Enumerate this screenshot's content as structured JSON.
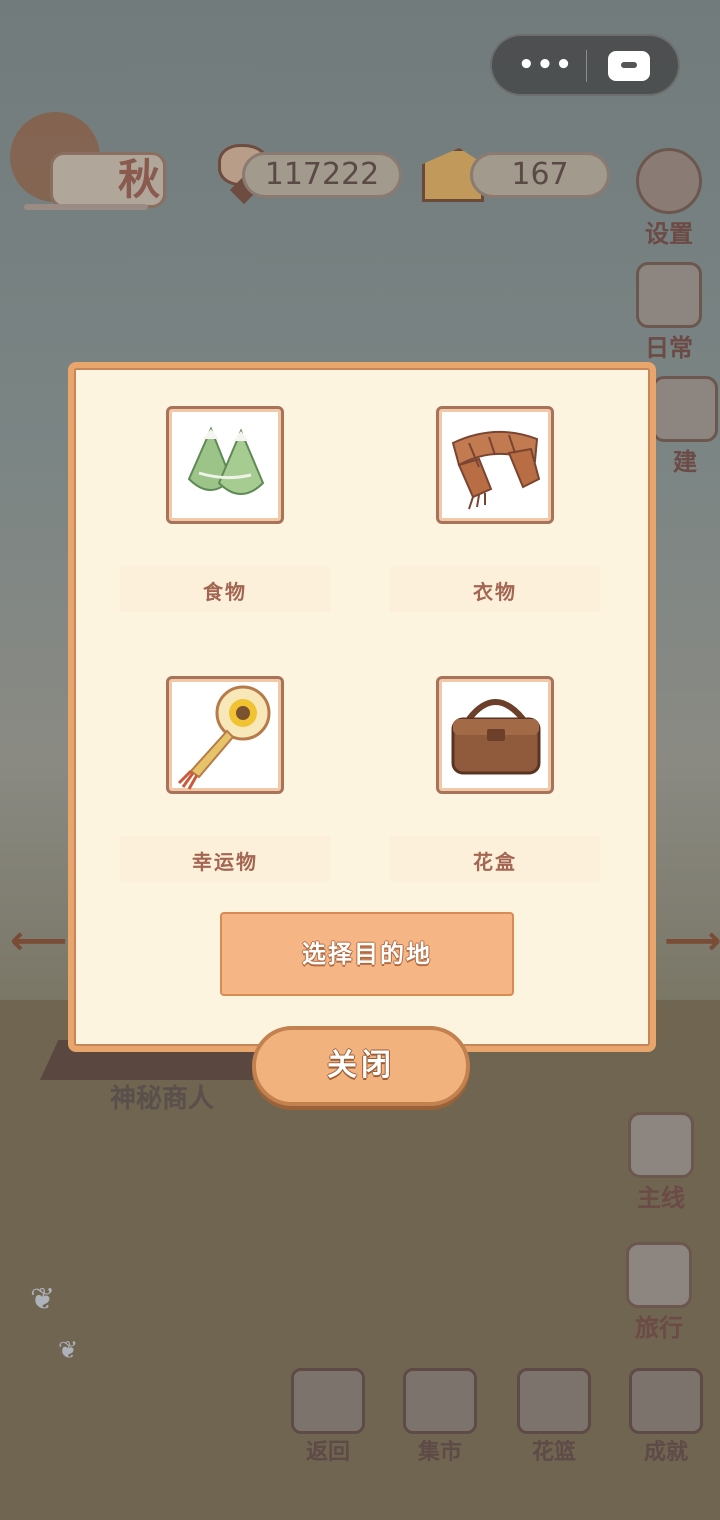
{
  "hud": {
    "fish_count": "117222",
    "cheese_count": "167",
    "season_label": "秋"
  },
  "side_buttons": {
    "settings": "设置",
    "daily": "日常",
    "build": "建",
    "main_quest": "主线",
    "travel": "旅行"
  },
  "background": {
    "mystery_merchant": "神秘商人"
  },
  "bottom_nav": {
    "back": "返回",
    "market": "集市",
    "flower_basket": "花篮",
    "achievements": "成就"
  },
  "modal": {
    "categories": [
      {
        "label": "食物",
        "icon": "zongzi-food-icon"
      },
      {
        "label": "衣物",
        "icon": "scarf-clothing-icon"
      },
      {
        "label": "幸运物",
        "icon": "sunflower-charm-icon"
      },
      {
        "label": "花盒",
        "icon": "flower-box-icon"
      }
    ],
    "choose_destination": "选择目的地",
    "close": "关闭"
  },
  "colors": {
    "modal_bg": "#fdf4e0",
    "modal_border": "#e8a66c",
    "button_orange": "#f6b584",
    "label_text": "#a36652"
  }
}
